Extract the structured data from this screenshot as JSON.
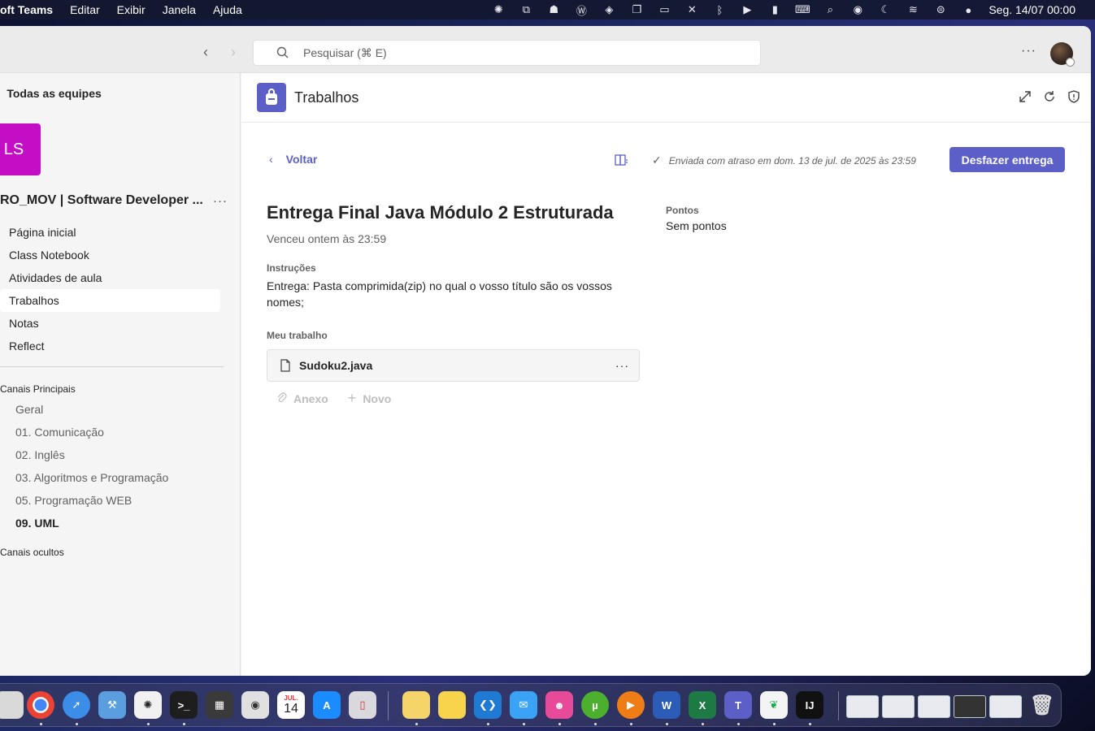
{
  "menubar": {
    "app_name": "oft Teams",
    "menus": [
      "Editar",
      "Exibir",
      "Janela",
      "Ajuda"
    ],
    "status_icons": [
      "chatgpt-icon",
      "screen-share-icon",
      "robot-icon",
      "wordpress-icon",
      "layers-icon",
      "window-icon",
      "display-icon",
      "mute-icon",
      "bluetooth-icon",
      "play-icon",
      "battery-icon",
      "keyboard-icon",
      "search-icon",
      "user-icon",
      "moon-icon",
      "wifi-icon",
      "control-center-icon",
      "siri-icon"
    ],
    "clock": "Seg. 14/07  00:00"
  },
  "titlebar": {
    "search_placeholder": "Pesquisar (⌘ E)"
  },
  "sidebar": {
    "all_teams": "Todas as equipes",
    "team_initials": "LS",
    "team_name": "RO_MOV | Software Developer ...",
    "nav": [
      "Página inicial",
      "Class Notebook",
      "Atividades de aula",
      "Trabalhos",
      "Notas",
      "Reflect"
    ],
    "active_nav": "Trabalhos",
    "main_channels_label": "Canais Principais",
    "channels": [
      "Geral",
      "01. Comunicação",
      "02. Inglês",
      "03. Algoritmos e Programação",
      "05. Programação WEB",
      "09. UML"
    ],
    "hidden_channels_label": "Canais ocultos"
  },
  "main": {
    "app_title": "Trabalhos",
    "back_label": "Voltar",
    "status_text": "Enviada com atraso em dom. 13 de jul. de 2025 às 23:59",
    "undo_button": "Desfazer entrega",
    "assignment_title": "Entrega Final Java Módulo 2 Estruturada",
    "due": "Venceu ontem às 23:59",
    "instructions_label": "Instruções",
    "instructions_text": "Entrega: Pasta comprimida(zip) no qual o vosso título são os vossos nomes;",
    "my_work_label": "Meu trabalho",
    "file_name": "Sudoku2.java",
    "attach_label": "Anexo",
    "new_label": "Novo",
    "points_label": "Pontos",
    "points_value": "Sem pontos"
  },
  "colors": {
    "accent": "#5b5fc7",
    "team_tile": "#c30ec6"
  },
  "dock": {
    "calendar_month": "JUL.",
    "calendar_day": "14"
  }
}
